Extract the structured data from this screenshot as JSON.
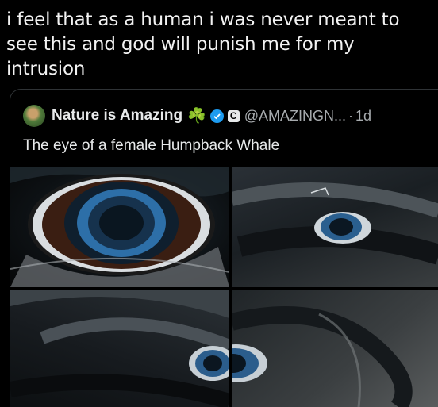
{
  "meme": {
    "caption": "i feel that as a human i was never meant to see this and god will punish me for my intrusion"
  },
  "tweet": {
    "display_name": "Nature is Amazing",
    "name_emoji": "☘️",
    "badge_letter": "C",
    "handle": "@AMAZINGN...",
    "separator": "·",
    "time": "1d",
    "text": "The eye of a female Humpback Whale"
  },
  "colors": {
    "background": "#000000",
    "verified_blue": "#1d9bf0",
    "muted_text": "#a7abae"
  }
}
